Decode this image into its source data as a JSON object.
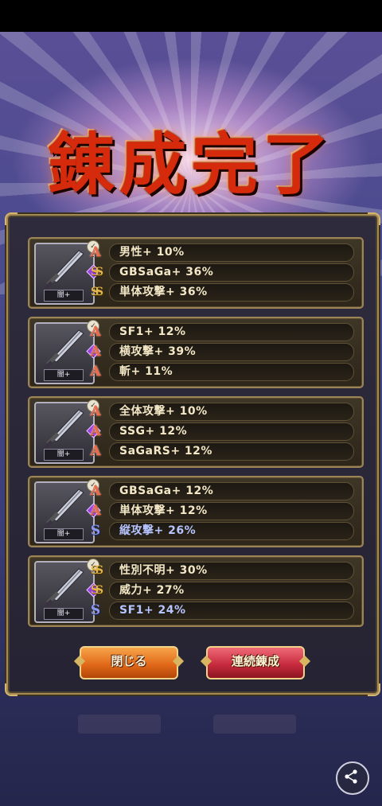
{
  "title": "錬成完了",
  "cards": [
    {
      "weapon_tag": "闇+",
      "rows": [
        {
          "rank": "A",
          "text": "男性+ 10%",
          "color": "normal"
        },
        {
          "rank": "SS",
          "text": "GBSaGa+ 36%",
          "color": "normal"
        },
        {
          "rank": "SS",
          "text": "単体攻撃+ 36%",
          "color": "normal"
        }
      ]
    },
    {
      "weapon_tag": "闇+",
      "rows": [
        {
          "rank": "A",
          "text": "SF1+ 12%",
          "color": "normal"
        },
        {
          "rank": "A",
          "text": "横攻撃+ 39%",
          "color": "normal"
        },
        {
          "rank": "A",
          "text": "斬+ 11%",
          "color": "normal"
        }
      ]
    },
    {
      "weapon_tag": "闇+",
      "rows": [
        {
          "rank": "A",
          "text": "全体攻撃+ 10%",
          "color": "normal"
        },
        {
          "rank": "A",
          "text": "SSG+ 12%",
          "color": "normal"
        },
        {
          "rank": "A",
          "text": "SaGaRS+ 12%",
          "color": "normal"
        }
      ]
    },
    {
      "weapon_tag": "闇+",
      "rows": [
        {
          "rank": "A",
          "text": "GBSaGa+ 12%",
          "color": "normal"
        },
        {
          "rank": "A",
          "text": "単体攻撃+ 12%",
          "color": "normal"
        },
        {
          "rank": "S",
          "text": "縦攻撃+ 26%",
          "color": "blue"
        }
      ]
    },
    {
      "weapon_tag": "闇+",
      "rows": [
        {
          "rank": "SS",
          "text": "性別不明+ 30%",
          "color": "normal"
        },
        {
          "rank": "SS",
          "text": "威力+ 27%",
          "color": "normal"
        },
        {
          "rank": "S",
          "text": "SF1+ 24%",
          "color": "blue"
        }
      ]
    }
  ],
  "buttons": {
    "close_label": "閉じる",
    "continue_label": "連続錬成"
  },
  "icons": {
    "weapon": "sword-icon",
    "share": "share-icon"
  },
  "colors": {
    "title_red": "#d62a0c",
    "frame_gold": "#a58a52",
    "close_orange": "#e26a1a",
    "continue_red": "#c82c3e"
  }
}
